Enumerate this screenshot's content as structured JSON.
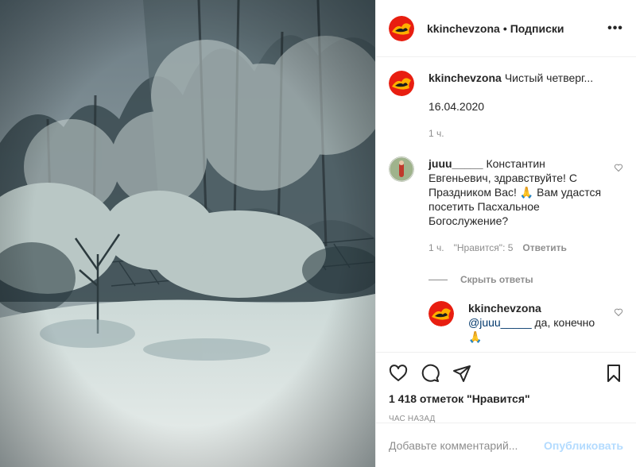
{
  "post": {
    "author": "kkinchevzona",
    "follow_label": "Подписки",
    "more_label": "•••",
    "caption": {
      "user": "kkinchevzona",
      "text": "Чистый четверг...",
      "date": "16.04.2020",
      "time": "1 ч."
    },
    "comments": [
      {
        "user": "juuu_____",
        "text": "Константин Евгеньевич, здравствуйте! С Праздником Вас! 🙏 Вам удастся посетить Пасхальное Богослужение?",
        "time": "1 ч.",
        "likes": "\"Нравится\": 5",
        "reply_label": "Ответить"
      }
    ],
    "hide_replies_label": "Скрыть ответы",
    "reply": {
      "user": "kkinchevzona",
      "mention": "@juuu_____",
      "text": " да, конечно",
      "emoji": "🙏"
    },
    "likes_count": "1 418 отметок \"Нравится\"",
    "posted_ago": "ЧАС НАЗАД",
    "add_comment_placeholder": "Добавьте комментарий...",
    "publish_label": "Опубликовать",
    "icons": [
      "heart-icon",
      "comment-icon",
      "share-icon",
      "bookmark-icon",
      "more-icon"
    ],
    "colors": {
      "link": "#00376b",
      "publish": "#b3dbff",
      "muted": "#8e8e8e"
    }
  }
}
